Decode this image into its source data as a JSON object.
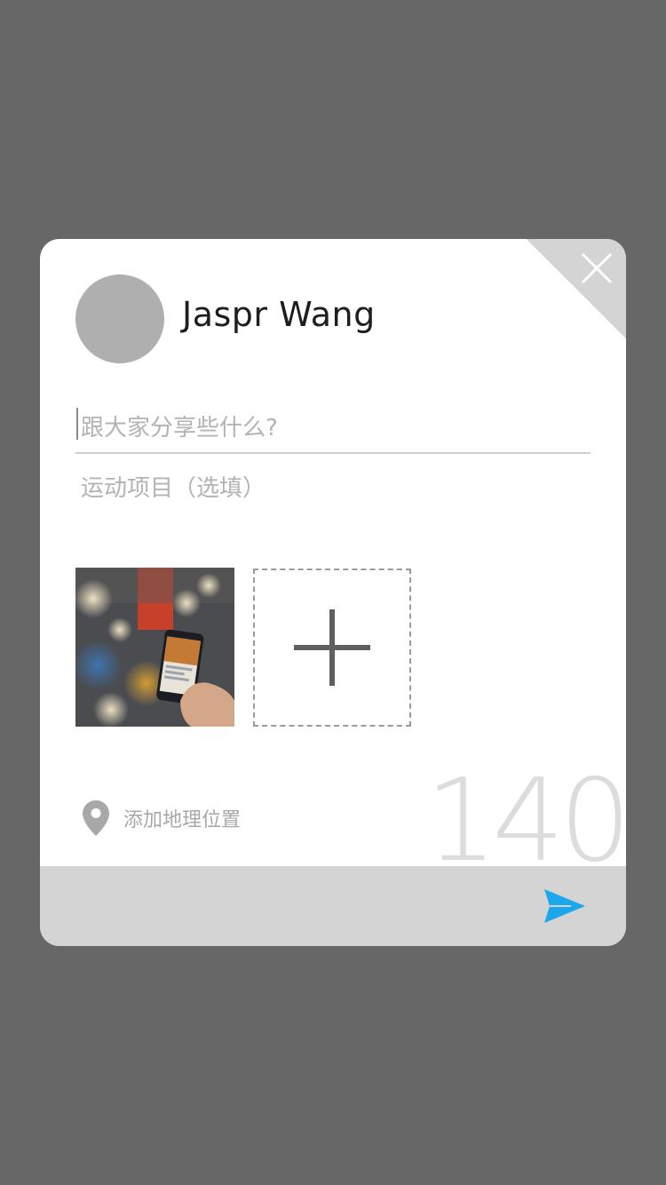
{
  "user": {
    "name": "Jaspr Wang"
  },
  "compose": {
    "share_placeholder": "跟大家分享些什么?",
    "sport_placeholder": "运动项目（选填）"
  },
  "location": {
    "label": "添加地理位置"
  },
  "counter": {
    "remaining": "140"
  },
  "icons": {
    "close": "close-icon",
    "add": "plus-icon",
    "location": "map-pin-icon",
    "send": "send-icon"
  },
  "colors": {
    "accent": "#1aa7ec",
    "backdrop": "#676767",
    "footer": "#d4d4d4"
  }
}
